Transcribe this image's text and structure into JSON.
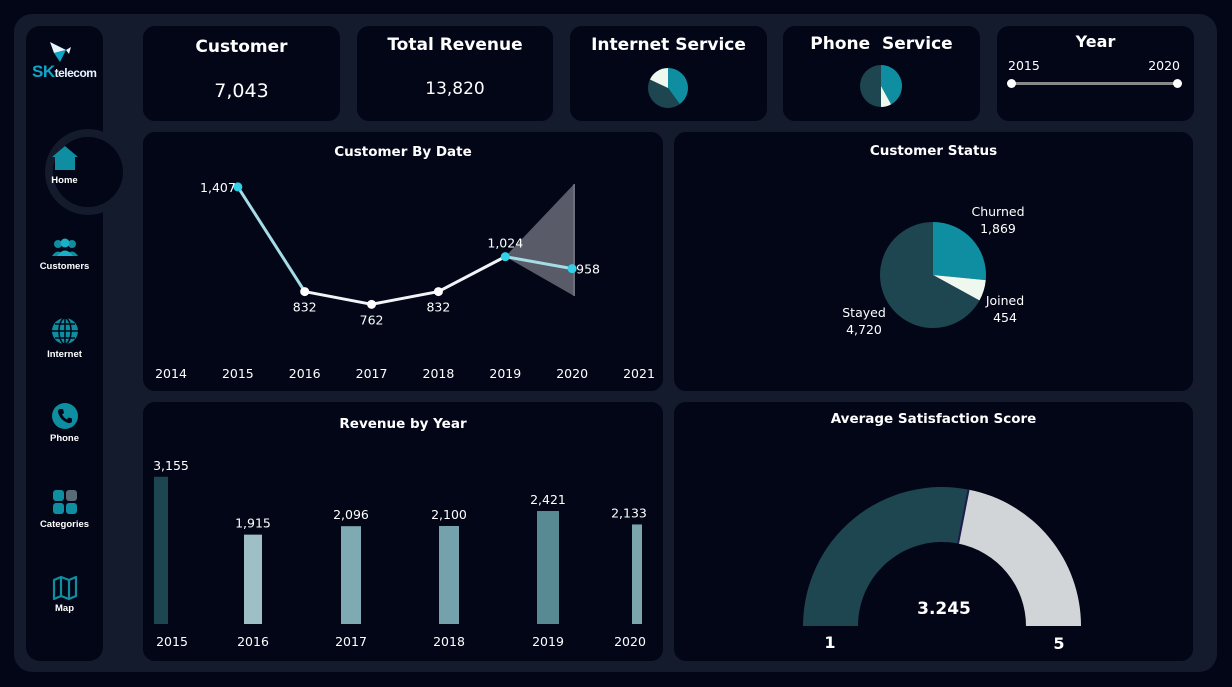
{
  "colors": {
    "background": "#020617",
    "frame": "#141b2c",
    "accent_teal": "#0e8ea0",
    "dark_teal": "#1d4650",
    "light_line": "#a5dde6",
    "point_cyan": "#33d0e8",
    "gauge_light": "#d1d5d8",
    "jon_white": "#eef8ee"
  },
  "brand": {
    "logo_main": "SK",
    "logo_sub": "telecom"
  },
  "nav": [
    {
      "label": "Home",
      "icon": "home-icon"
    },
    {
      "label": "Customers",
      "icon": "users-icon"
    },
    {
      "label": "Internet",
      "icon": "globe-icon"
    },
    {
      "label": "Phone",
      "icon": "phone-icon"
    },
    {
      "label": "Categories",
      "icon": "grid-icon"
    },
    {
      "label": "Map",
      "icon": "map-icon"
    }
  ],
  "kpis": {
    "customer": {
      "title": "Customer",
      "value": "7,043"
    },
    "revenue": {
      "title": "Total Revenue",
      "value": "13,820"
    },
    "internet": {
      "title": "Internet Service"
    },
    "phone": {
      "title": "Phone  Service"
    }
  },
  "year_filter": {
    "title": "Year",
    "min_label": "2015",
    "max_label": "2020",
    "range": [
      2015,
      2020
    ]
  },
  "chart_data": [
    {
      "type": "pie",
      "title": "Internet Service",
      "slices": [
        {
          "value": 0.4,
          "color": "#0e8ea0"
        },
        {
          "value": 0.42,
          "color": "#1d4650"
        },
        {
          "value": 0.18,
          "color": "#eef8ee"
        }
      ]
    },
    {
      "type": "pie",
      "title": "Phone  Service",
      "slices": [
        {
          "value": 0.42,
          "color": "#0e8ea0"
        },
        {
          "value": 0.08,
          "color": "#eef8ee"
        },
        {
          "value": 0.5,
          "color": "#1d4650"
        }
      ]
    },
    {
      "type": "line",
      "title": "Customer By Date",
      "x_ticks": [
        "2014",
        "2015",
        "2016",
        "2017",
        "2018",
        "2019",
        "2020",
        "2021"
      ],
      "x": [
        2015,
        2016,
        2017,
        2018,
        2019,
        2020
      ],
      "values": [
        1407,
        832,
        762,
        832,
        1024,
        958
      ],
      "labels": [
        "1,407",
        "832",
        "762",
        "832",
        "1,024",
        "958"
      ],
      "xlim": [
        2014,
        2021
      ],
      "ylim": [
        500,
        1500
      ]
    },
    {
      "type": "pie",
      "title": "Customer Status",
      "slices": [
        {
          "label": "Churned",
          "value": 1869,
          "value_label": "1,869",
          "color": "#0e8ea0"
        },
        {
          "label": "Joined",
          "value": 454,
          "value_label": "454",
          "color": "#eef8ee"
        },
        {
          "label": "Stayed",
          "value": 4720,
          "value_label": "4,720",
          "color": "#1d4650"
        }
      ]
    },
    {
      "type": "bar",
      "title": "Revenue by Year",
      "categories": [
        "2015",
        "2016",
        "2017",
        "2018",
        "2019",
        "2020"
      ],
      "values": [
        3155,
        1915,
        2096,
        2100,
        2421,
        2133
      ],
      "labels": [
        "3,155",
        "1,915",
        "2,096",
        "2,100",
        "2,421",
        "2,133"
      ],
      "colors": [
        "#1d4650",
        "#9ebfc5",
        "#80aab3",
        "#74a1ab",
        "#588a94",
        "#7ca6ae"
      ],
      "ylim": [
        0,
        3300
      ]
    },
    {
      "type": "gauge",
      "title": "Average Satisfaction Score",
      "value": 3.245,
      "value_label": "3.245",
      "min": 1,
      "max": 5,
      "min_label": "1",
      "max_label": "5"
    }
  ]
}
